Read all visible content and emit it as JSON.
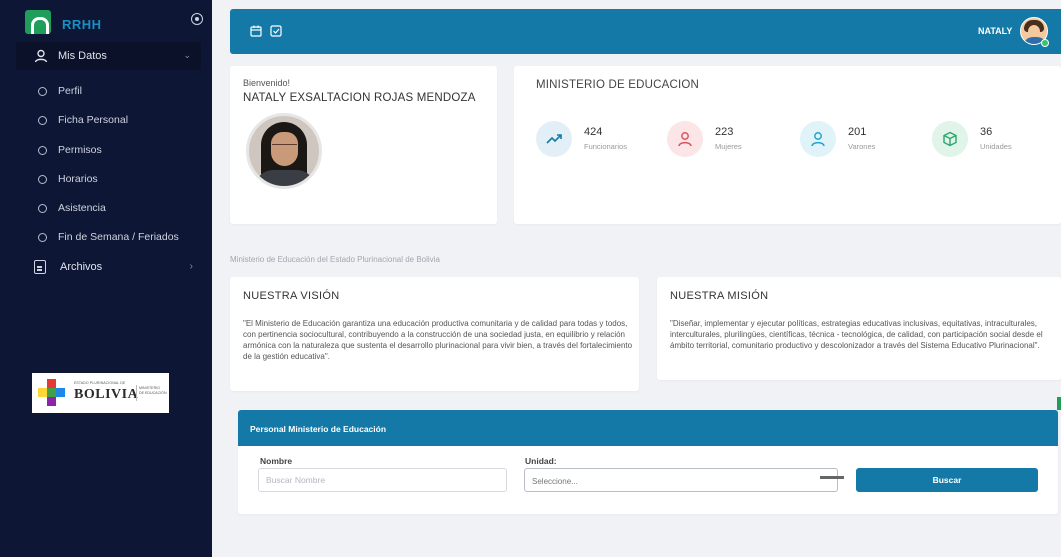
{
  "app": {
    "brand": "RRHH",
    "user_name": "NATALY"
  },
  "sidebar": {
    "group": {
      "label": "Mis Datos"
    },
    "items": [
      {
        "label": "Perfil"
      },
      {
        "label": "Ficha Personal"
      },
      {
        "label": "Permisos"
      },
      {
        "label": "Horarios"
      },
      {
        "label": "Asistencia"
      },
      {
        "label": "Fin de Semana / Feriados"
      }
    ],
    "archivos": {
      "label": "Archivos"
    },
    "logo": {
      "small_text": "ESTADO PLURINACIONAL DE",
      "country": "BOLIVIA",
      "ministry_line1": "MINISTERIO",
      "ministry_line2": "DE EDUCACIÓN"
    }
  },
  "welcome": {
    "greeting": "Bienvenido!",
    "full_name": "NATALY EXSALTACION ROJAS MENDOZA"
  },
  "ministry": {
    "title": "MINISTERIO DE EDUCACION",
    "stats": [
      {
        "value": "424",
        "label": "Funcionarios",
        "icon": "trending-up-icon",
        "color": "#1479a6",
        "bg": "#e3eff7"
      },
      {
        "value": "223",
        "label": "Mujeres",
        "icon": "user-icon",
        "color": "#e0525e",
        "bg": "#fbe5e7"
      },
      {
        "value": "201",
        "label": "Varones",
        "icon": "user-icon",
        "color": "#1fa6c9",
        "bg": "#e0f3f9"
      },
      {
        "value": "36",
        "label": "Unidades",
        "icon": "box-icon",
        "color": "#27a86a",
        "bg": "#e0f4ea"
      }
    ]
  },
  "page_subtitle": "Ministerio de Educación del Estado Plurinacional de Bolivia",
  "vision": {
    "title": "NUESTRA VISIÓN",
    "text": "\"El Ministerio de Educación garantiza una educación productiva comunitaria y de calidad para todas y todos, con pertinencia sociocultural, contribuyendo a la construcción de una sociedad justa, en equilibrio y relación armónica con la naturaleza que sustenta el desarrollo plurinacional para vivir bien, a través del fortalecimiento de la gestión educativa\"."
  },
  "mision": {
    "title": "NUESTRA MISIÓN",
    "text": "\"Diseñar, implementar y ejecutar políticas, estrategias educativas inclusivas, equitativas, intraculturales, interculturales, plurilingües, científicas, técnica - tecnológica, de calidad, con participación social desde el ámbito territorial, comunitario productivo y descolonizador a través del Sistema Educativo Plurinacional\"."
  },
  "personal": {
    "header": "Personal Ministerio de Educación",
    "nombre_label": "Nombre",
    "nombre_placeholder": "Buscar Nombre",
    "unidad_label": "Unidad:",
    "unidad_selected": "Seleccione...",
    "search_button": "Buscar"
  },
  "colors": {
    "primary": "#1479a6",
    "sidebar_bg": "#0d1634",
    "page_bg": "#f1f2f6"
  }
}
